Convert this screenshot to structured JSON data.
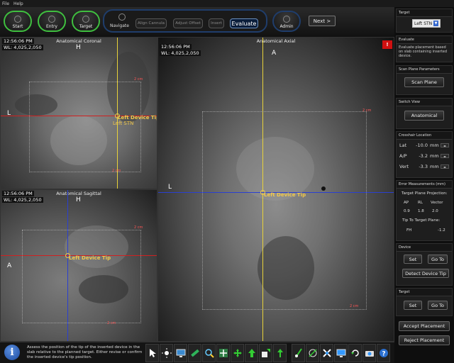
{
  "menu": {
    "file": "File",
    "help": "Help"
  },
  "workflow": {
    "start": "Start",
    "entry": "Entry",
    "target": "Target",
    "navigate": "Navigate",
    "align_cannula": "Align Cannula",
    "adjust_offset": "Adjust Offset",
    "insert": "Insert",
    "evaluate": "Evaluate",
    "admin": "Admin",
    "next": "Next >"
  },
  "views": {
    "coronal": {
      "title": "Anatomical Coronal",
      "time": "12:56:06 PM",
      "wl": "WL: 4,025,2,050",
      "top": "H",
      "left": "L",
      "tip_label": "Left Device Tip",
      "target_label": "Left STN",
      "scale_label": "2 cm"
    },
    "sagittal": {
      "title": "Anatomical Sagittal",
      "time": "12:56:06 PM",
      "wl": "WL: 4,025,2,050",
      "top": "H",
      "left": "A",
      "tip_label": "Left Device Tip",
      "scale_label": "2 cm"
    },
    "axial": {
      "title": "Anatomical Axial",
      "time": "12:56:06 PM",
      "wl": "WL: 4,025,2,050",
      "top": "A",
      "left": "L",
      "tip_label": "Left Device Tip",
      "scale_label": "2 cm",
      "flag": "!"
    }
  },
  "panel": {
    "target_section": "Target",
    "target_value": "Left STN",
    "evaluate_section": "Evaluate",
    "evaluate_text": "Evaluate placement based on slab containing inserted device.",
    "scan_section": "Scan Plane Parameters",
    "scan_btn": "Scan Plane",
    "switch_section": "Switch View",
    "switch_btn": "Anatomical",
    "crosshair_section": "Crosshair Location",
    "crosshair": [
      {
        "label": "Lat",
        "value": "-10.0",
        "unit": "mm"
      },
      {
        "label": "A/P",
        "value": "-3.2",
        "unit": "mm"
      },
      {
        "label": "Vert",
        "value": "-3.3",
        "unit": "mm"
      }
    ],
    "error_section": "Error Measurements (mm)",
    "error_proj": "Target Plane Projection:",
    "error_cols": [
      "AP",
      "RL",
      "Vector"
    ],
    "error_vals": [
      "0.9",
      "1.8",
      "2.0"
    ],
    "tip_plane": "Tip To Target Plane:",
    "fh_label": "FH",
    "fh_value": "-1.2",
    "device_section": "Device",
    "set": "Set",
    "goto": "Go To",
    "detect": "Detect Device Tip",
    "target2_section": "Target",
    "accept": "Accept Placement",
    "reject": "Reject Placement"
  },
  "status": {
    "text": "Assess the position of the tip of the inserted device in the slab relative to the planned target. Either revise or confirm the inserted device's tip position."
  },
  "colors": {
    "workflow_green": "#3fbf3f",
    "nav_blue": "#1f3d6b",
    "crosshair_yellow": "#e8d23a",
    "crosshair_red": "#d02020",
    "crosshair_blue": "#2a3fd0",
    "tip_yellow": "#f2c94c"
  }
}
